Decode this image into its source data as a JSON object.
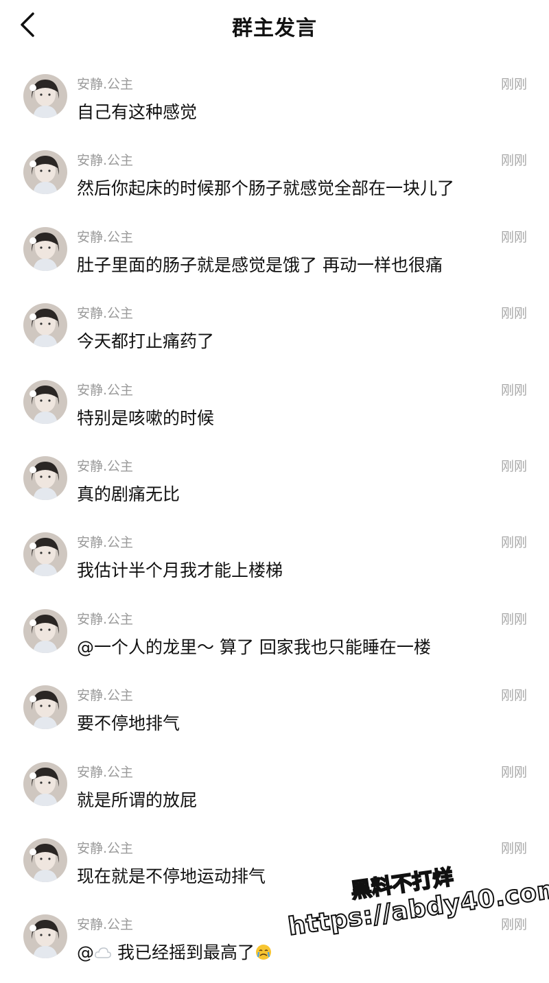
{
  "header": {
    "title": "群主发言",
    "back_icon": "chevron-left-icon"
  },
  "messages": [
    {
      "sender": "安静.公主",
      "time": "刚刚",
      "text": "自己有这种感觉"
    },
    {
      "sender": "安静.公主",
      "time": "刚刚",
      "text": "然后你起床的时候那个肠子就感觉全部在一块儿了"
    },
    {
      "sender": "安静.公主",
      "time": "刚刚",
      "text": "肚子里面的肠子就是感觉是饿了 再动一样也很痛"
    },
    {
      "sender": "安静.公主",
      "time": "刚刚",
      "text": "今天都打止痛药了"
    },
    {
      "sender": "安静.公主",
      "time": "刚刚",
      "text": "特别是咳嗽的时候"
    },
    {
      "sender": "安静.公主",
      "time": "刚刚",
      "text": "真的剧痛无比"
    },
    {
      "sender": "安静.公主",
      "time": "刚刚",
      "text": "我估计半个月我才能上楼梯"
    },
    {
      "sender": "安静.公主",
      "time": "刚刚",
      "text": "@一个人的龙里～ 算了 回家我也只能睡在一楼"
    },
    {
      "sender": "安静.公主",
      "time": "刚刚",
      "text": "要不停地排气"
    },
    {
      "sender": "安静.公主",
      "time": "刚刚",
      "text": "就是所谓的放屁"
    },
    {
      "sender": "安静.公主",
      "time": "刚刚",
      "text": "现在就是不停地运动排气"
    },
    {
      "sender": "安静.公主",
      "time": "刚刚",
      "text_prefix": "@",
      "text_suffix": " 我已经摇到最高了"
    }
  ],
  "watermark": {
    "line1": "黑料不打烊",
    "line2": "https://abdy40.com"
  }
}
